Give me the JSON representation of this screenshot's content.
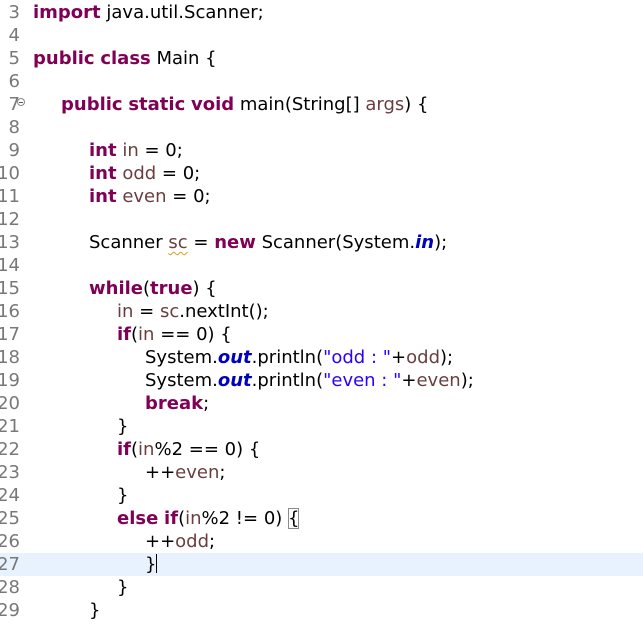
{
  "editor": {
    "current_line": "27",
    "lines": [
      {
        "num": "3",
        "tokens": [
          {
            "t": "import",
            "k": "kw"
          },
          {
            "t": " java.util.Scanner;"
          }
        ]
      },
      {
        "num": "4",
        "tokens": []
      },
      {
        "num": "5",
        "tokens": [
          {
            "t": "public",
            "k": "kw"
          },
          {
            "t": " "
          },
          {
            "t": "class",
            "k": "kw"
          },
          {
            "t": " Main {"
          }
        ]
      },
      {
        "num": "6",
        "tokens": []
      },
      {
        "num": "7",
        "fold": true,
        "tokens": [
          {
            "t": "public",
            "k": "kw"
          },
          {
            "t": " "
          },
          {
            "t": "static",
            "k": "kw"
          },
          {
            "t": " "
          },
          {
            "t": "void",
            "k": "kw"
          },
          {
            "t": " main(String[] "
          },
          {
            "t": "args",
            "k": "var"
          },
          {
            "t": ") {"
          }
        ]
      },
      {
        "num": "8",
        "tokens": []
      },
      {
        "num": "9",
        "tokens": [
          {
            "t": "int",
            "k": "kw"
          },
          {
            "t": " "
          },
          {
            "t": "in",
            "k": "var"
          },
          {
            "t": " = 0;"
          }
        ]
      },
      {
        "num": "10",
        "tokens": [
          {
            "t": "int",
            "k": "kw"
          },
          {
            "t": " "
          },
          {
            "t": "odd",
            "k": "var"
          },
          {
            "t": " = 0;"
          }
        ]
      },
      {
        "num": "11",
        "tokens": [
          {
            "t": "int",
            "k": "kw"
          },
          {
            "t": " "
          },
          {
            "t": "even",
            "k": "var"
          },
          {
            "t": " = 0;"
          }
        ]
      },
      {
        "num": "12",
        "tokens": []
      },
      {
        "num": "13",
        "tokens": [
          {
            "t": "Scanner "
          },
          {
            "t": "sc",
            "k": "var squiggle"
          },
          {
            "t": " = "
          },
          {
            "t": "new",
            "k": "kw"
          },
          {
            "t": " Scanner(System."
          },
          {
            "t": "in",
            "k": "static"
          },
          {
            "t": ");"
          }
        ]
      },
      {
        "num": "14",
        "tokens": []
      },
      {
        "num": "15",
        "tokens": [
          {
            "t": "while",
            "k": "kw"
          },
          {
            "t": "("
          },
          {
            "t": "true",
            "k": "kw"
          },
          {
            "t": ") {"
          }
        ]
      },
      {
        "num": "16",
        "tokens": [
          {
            "t": "in",
            "k": "var"
          },
          {
            "t": " = "
          },
          {
            "t": "sc",
            "k": "var"
          },
          {
            "t": ".nextInt();"
          }
        ]
      },
      {
        "num": "17",
        "tokens": [
          {
            "t": "if",
            "k": "kw"
          },
          {
            "t": "("
          },
          {
            "t": "in",
            "k": "var"
          },
          {
            "t": " == 0) {"
          }
        ]
      },
      {
        "num": "18",
        "tokens": [
          {
            "t": "System."
          },
          {
            "t": "out",
            "k": "static"
          },
          {
            "t": ".println("
          },
          {
            "t": "\"odd : \"",
            "k": "str"
          },
          {
            "t": "+"
          },
          {
            "t": "odd",
            "k": "var"
          },
          {
            "t": ");"
          }
        ]
      },
      {
        "num": "19",
        "tokens": [
          {
            "t": "System."
          },
          {
            "t": "out",
            "k": "static"
          },
          {
            "t": ".println("
          },
          {
            "t": "\"even : \"",
            "k": "str"
          },
          {
            "t": "+"
          },
          {
            "t": "even",
            "k": "var"
          },
          {
            "t": ");"
          }
        ]
      },
      {
        "num": "20",
        "tokens": [
          {
            "t": "break",
            "k": "kw"
          },
          {
            "t": ";"
          }
        ]
      },
      {
        "num": "21",
        "tokens": [
          {
            "t": "}"
          }
        ]
      },
      {
        "num": "22",
        "tokens": [
          {
            "t": "if",
            "k": "kw"
          },
          {
            "t": "("
          },
          {
            "t": "in",
            "k": "var"
          },
          {
            "t": "%2 == 0) {"
          }
        ]
      },
      {
        "num": "23",
        "tokens": [
          {
            "t": "++"
          },
          {
            "t": "even",
            "k": "var"
          },
          {
            "t": ";"
          }
        ]
      },
      {
        "num": "24",
        "tokens": [
          {
            "t": "}"
          }
        ]
      },
      {
        "num": "25",
        "tokens": [
          {
            "t": "else",
            "k": "kw"
          },
          {
            "t": " "
          },
          {
            "t": "if",
            "k": "kw"
          },
          {
            "t": "("
          },
          {
            "t": "in",
            "k": "var"
          },
          {
            "t": "%2 != 0) "
          },
          {
            "t": "{",
            "k": "bracket-box"
          }
        ]
      },
      {
        "num": "26",
        "tokens": [
          {
            "t": "++"
          },
          {
            "t": "odd",
            "k": "var"
          },
          {
            "t": ";"
          }
        ]
      },
      {
        "num": "27",
        "tokens": [
          {
            "t": "}"
          },
          {
            "t": "",
            "k": "caret"
          }
        ]
      },
      {
        "num": "28",
        "tokens": [
          {
            "t": "}"
          }
        ]
      },
      {
        "num": "29",
        "tokens": [
          {
            "t": "}"
          }
        ]
      }
    ]
  }
}
